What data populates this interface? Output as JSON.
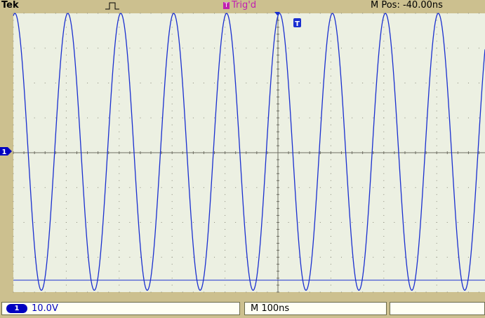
{
  "header": {
    "brand": "Tek",
    "trigger_marker": "T",
    "trigger_status": "Trig'd",
    "horizontal_position": "M Pos: -40.00ns"
  },
  "footer": {
    "channel_badge": "1",
    "channel_scale": "10.0V",
    "timebase": "M 100ns",
    "extra_field": ""
  },
  "screen": {
    "channel_marker": "1",
    "trigger_point_marker": "T"
  },
  "colors": {
    "bezel": "#ccc08f",
    "graticule_background": "#ecf0e2",
    "waveform": "#1a2fd0",
    "trigger_label": "#c020b0",
    "channel1": "#0000c0"
  },
  "chart_data": {
    "type": "line",
    "title": "",
    "xlabel": "",
    "ylabel": "",
    "x_divisions": 10,
    "y_divisions": 8,
    "grid": true,
    "series": [
      {
        "name": "",
        "shape": "sine",
        "peak_div": 4.0,
        "trough_div": -3.95,
        "period_div": 1.0,
        "first_peak_div": 1.03
      }
    ]
  }
}
